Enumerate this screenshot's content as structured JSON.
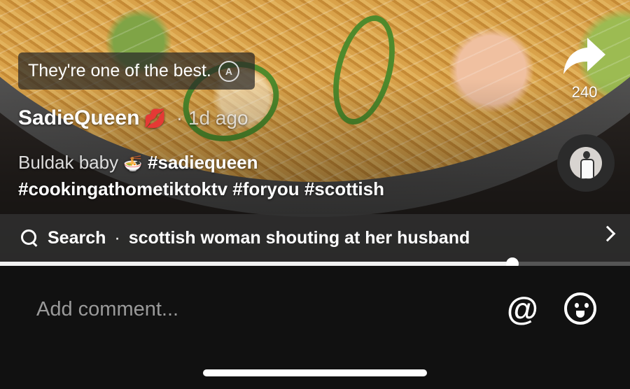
{
  "caption": {
    "text": "They're one of the best.",
    "translate_icon": "translate-icon"
  },
  "share": {
    "icon": "share-arrow-icon",
    "count": "240"
  },
  "author": {
    "name": "SadieQueen",
    "badge_emoji": "💋",
    "time": "· 1d ago"
  },
  "description": {
    "line1_plain": "Buldak baby",
    "line1_emoji": "🍜",
    "line1_tag": "#sadiequeen",
    "line2_tags": "#cookingathometiktoktv #foryou #scottish"
  },
  "search": {
    "label": "Search",
    "separator": "·",
    "query": "scottish woman shouting at her husband"
  },
  "progress": {
    "fraction": 0.813
  },
  "comment": {
    "placeholder": "Add comment...",
    "mention_symbol": "@"
  },
  "colors": {
    "background": "#111111",
    "progress_fill": "#f2f2f2",
    "lips": "#e0213a"
  }
}
